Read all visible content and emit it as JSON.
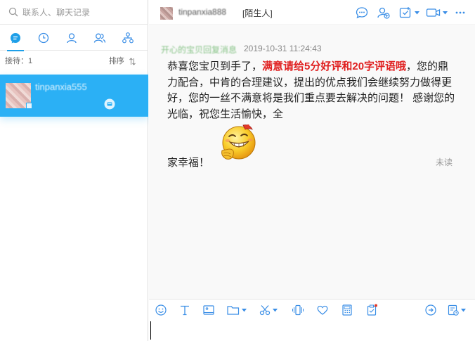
{
  "search": {
    "placeholder": "联系人、聊天记录",
    "icon": "search-icon"
  },
  "nav_tabs": [
    {
      "icon": "chat-bubble-icon",
      "active": true
    },
    {
      "icon": "clock-icon",
      "active": false
    },
    {
      "icon": "person-icon",
      "active": false
    },
    {
      "icon": "group-icon",
      "active": false
    },
    {
      "icon": "org-structure-icon",
      "active": false
    }
  ],
  "queue": {
    "label": "接待：1",
    "sort_label": "排序",
    "sort_icon": "sort-arrows-icon"
  },
  "sessions": [
    {
      "name": "tinpanxia555",
      "badge_icon": "chat-badge-icon"
    }
  ],
  "chat": {
    "contact_name": "tinpanxia888",
    "contact_tag": "[陌生人]",
    "header_buttons": [
      "message-icon",
      "add-contact-icon",
      "checklist-icon",
      "video-icon",
      "more-icon"
    ],
    "message": {
      "sender": "开心的宝贝回复消息",
      "time": "2019-10-31 11:24:43",
      "text_prefix": "恭喜您宝贝到手了，",
      "text_highlight": "满意请给5分好评和20字评语哦",
      "text_rest": "，您的鼎力配合，中肯的合理建议，提出的优点我们会继续努力做得更好，您的一丝不满意将是我们重点要去解决的问题！ 感谢您的光临，祝您生活愉快，全",
      "text_end": "家幸福！",
      "emoji": "grinning-fan-emoji",
      "status": "未读"
    }
  },
  "toolbar": [
    "emoji-icon",
    "text-format-icon",
    "image-icon",
    "folder-icon",
    "scissors-icon",
    "vibrate-icon",
    "heart-icon",
    "calculator-icon",
    "clipboard-icon",
    "reply-icon",
    "history-icon"
  ],
  "colors": {
    "accent": "#1e9fe8",
    "selected_session": "#2bb0f5",
    "highlight_text": "#e02020",
    "icon_blue": "#3a8ee6"
  }
}
